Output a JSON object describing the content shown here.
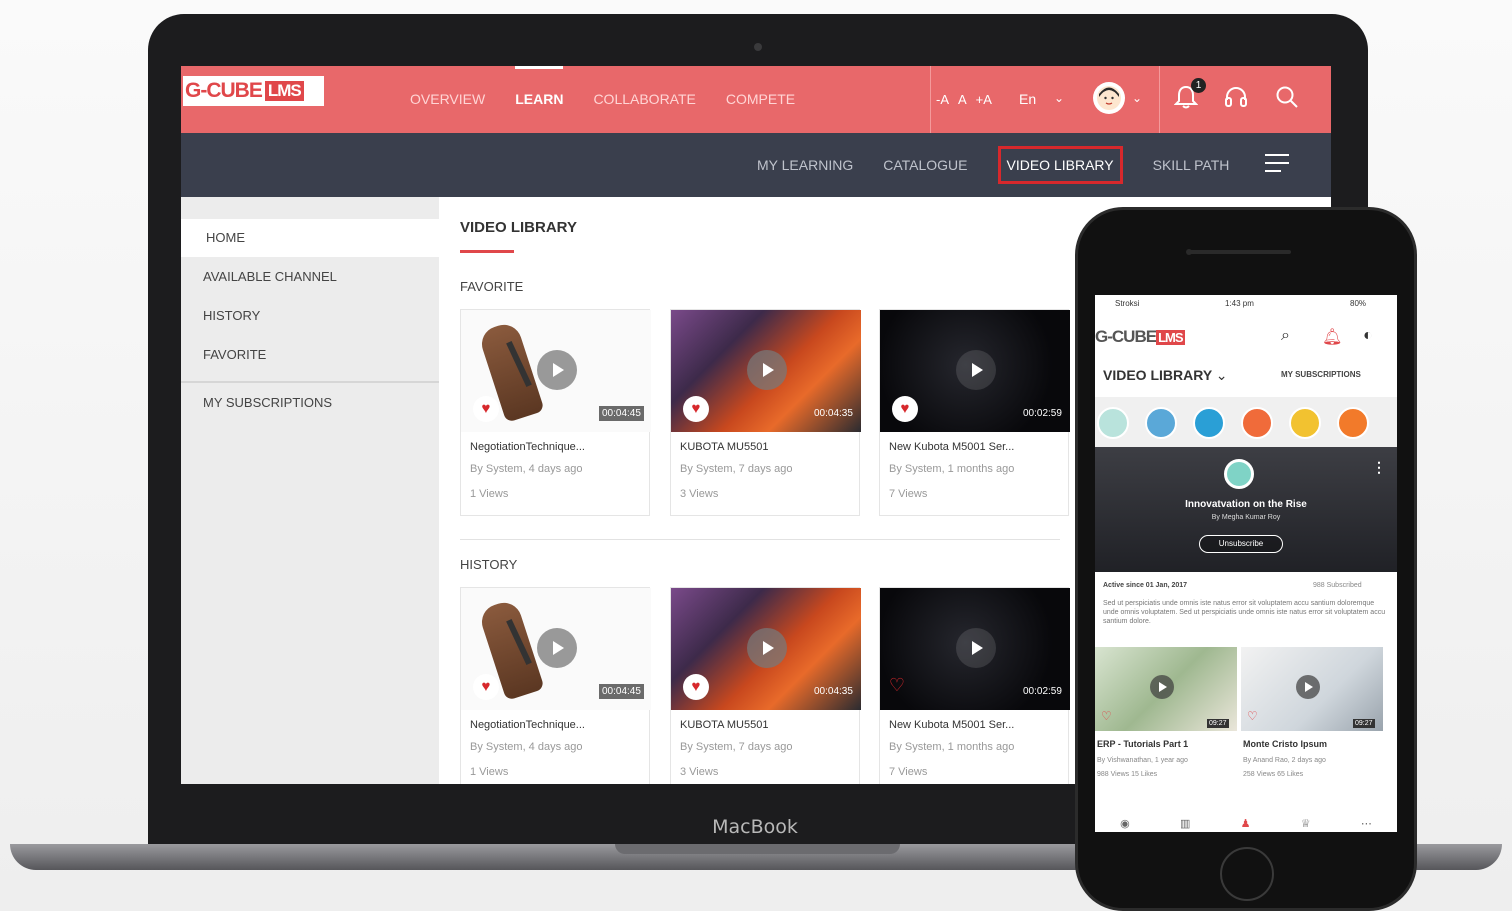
{
  "laptop": {
    "brand": "MacBook"
  },
  "app": {
    "logo_text": "G-CUBE",
    "logo_badge": "LMS",
    "main_nav": [
      "OVERVIEW",
      "LEARN",
      "COLLABORATE",
      "COMPETE"
    ],
    "active_main_nav": "LEARN",
    "font_controls": [
      "-A",
      "A",
      "+A"
    ],
    "language": "En",
    "notification_count": "1",
    "sub_nav": [
      "MY LEARNING",
      "CATALOGUE",
      "VIDEO LIBRARY",
      "SKILL PATH"
    ],
    "active_sub_nav": "VIDEO LIBRARY"
  },
  "sidebar": {
    "items": [
      "HOME",
      "AVAILABLE CHANNEL",
      "HISTORY",
      "FAVORITE",
      "MY SUBSCRIPTIONS"
    ]
  },
  "content": {
    "title": "VIDEO LIBRARY",
    "favorite_label": "FAVORITE",
    "history_label": "HISTORY",
    "favorite_cards": [
      {
        "title": "NegotiationTechnique...",
        "meta": "By  System, 4 days ago",
        "views": "1 Views",
        "duration": "00:04:45",
        "thumb": "hand",
        "favorited": true
      },
      {
        "title": "KUBOTA MU5501",
        "meta": "By  System, 7 days ago",
        "views": "3 Views",
        "duration": "00:04:35",
        "thumb": "tractor",
        "favorited": true
      },
      {
        "title": "New Kubota M5001 Ser...",
        "meta": "By  System, 1 months ago",
        "views": "7 Views",
        "duration": "00:02:59",
        "thumb": "dark",
        "favorited": true
      }
    ],
    "history_cards": [
      {
        "title": "NegotiationTechnique...",
        "meta": "By  System, 4 days ago",
        "views": "1 Views",
        "duration": "00:04:45",
        "thumb": "hand",
        "favorited": true
      },
      {
        "title": "KUBOTA MU5501",
        "meta": "By  System, 7 days ago",
        "views": "3 Views",
        "duration": "00:04:35",
        "thumb": "tractor",
        "favorited": true
      },
      {
        "title": "New Kubota M5001 Ser...",
        "meta": "By  System, 1 months ago",
        "views": "7 Views",
        "duration": "00:02:59",
        "thumb": "dark",
        "favorited": false
      }
    ]
  },
  "phone": {
    "status_carrier": "Stroksi",
    "status_time": "1:43 pm",
    "status_battery": "80%",
    "logo_text": "G-CUBE",
    "logo_badge": "LMS",
    "title": "VIDEO LIBRARY",
    "subscriptions_label": "MY SUBSCRIPTIONS",
    "channel_colors": [
      "#b9e3dc",
      "#5aa8d8",
      "#2a9fd6",
      "#f06b3a",
      "#f2c230",
      "#f27a2a"
    ],
    "banner_title": "Innovatvation on the Rise",
    "banner_by": "By Megha Kumar Roy",
    "unsubscribe_label": "Unsubscribe",
    "active_since": "Active since 01 Jan, 2017",
    "subscribed_count": "988 Subscribed",
    "description": "Sed ut perspiciatis unde omnis iste natus error sit voluptatem accu santium doloremque unde omnis voluptatem. Sed ut perspiciatis unde omnis iste natus error sit voluptatem accu santium dolore.",
    "cards": [
      {
        "title": "ERP - Tutorials Part 1",
        "by": "By Vishwanathan, 1 year ago",
        "stats": "988 Views    15 Likes",
        "duration": "09:27"
      },
      {
        "title": "Monte Cristo Ipsum",
        "by": "By Anand Rao, 2 days ago",
        "stats": "258 Views    65 Likes",
        "duration": "09:27"
      }
    ]
  }
}
